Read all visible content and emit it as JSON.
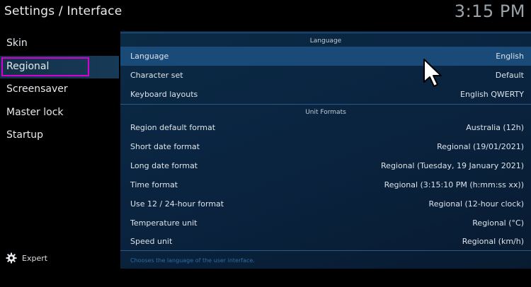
{
  "window": {
    "title": "Settings / Interface",
    "clock": "3:15 PM"
  },
  "sidebar": {
    "items": [
      {
        "label": "Skin"
      },
      {
        "label": "Regional"
      },
      {
        "label": "Screensaver"
      },
      {
        "label": "Master lock"
      },
      {
        "label": "Startup"
      }
    ],
    "active_index": 1,
    "expert_label": "Expert",
    "expert_icon": "gear-icon"
  },
  "groups": {
    "language": {
      "header": "Language",
      "rows": [
        {
          "label": "Language",
          "value": "English"
        },
        {
          "label": "Character set",
          "value": "Default"
        },
        {
          "label": "Keyboard layouts",
          "value": "English QWERTY"
        }
      ]
    },
    "unit_formats": {
      "header": "Unit Formats",
      "rows": [
        {
          "label": "Region default format",
          "value": "Australia (12h)"
        },
        {
          "label": "Short date format",
          "value": "Regional (19/01/2021)"
        },
        {
          "label": "Long date format",
          "value": "Regional (Tuesday, 19 January 2021)"
        },
        {
          "label": "Time format",
          "value": "Regional (3:15:10 PM (h:mm:ss xx))"
        },
        {
          "label": "Use 12 / 24-hour format",
          "value": "Regional (12-hour clock)"
        },
        {
          "label": "Temperature unit",
          "value": "Regional (°C)"
        },
        {
          "label": "Speed unit",
          "value": "Regional (km/h)"
        }
      ]
    }
  },
  "hint": "Chooses the language of the user interface.",
  "colors": {
    "focus_border": "#d400d4",
    "selected_row": "#1a4a78",
    "panel": "#0a2440",
    "hint_text": "#2f6aa6"
  },
  "cursor_icon": "mouse-pointer-icon"
}
